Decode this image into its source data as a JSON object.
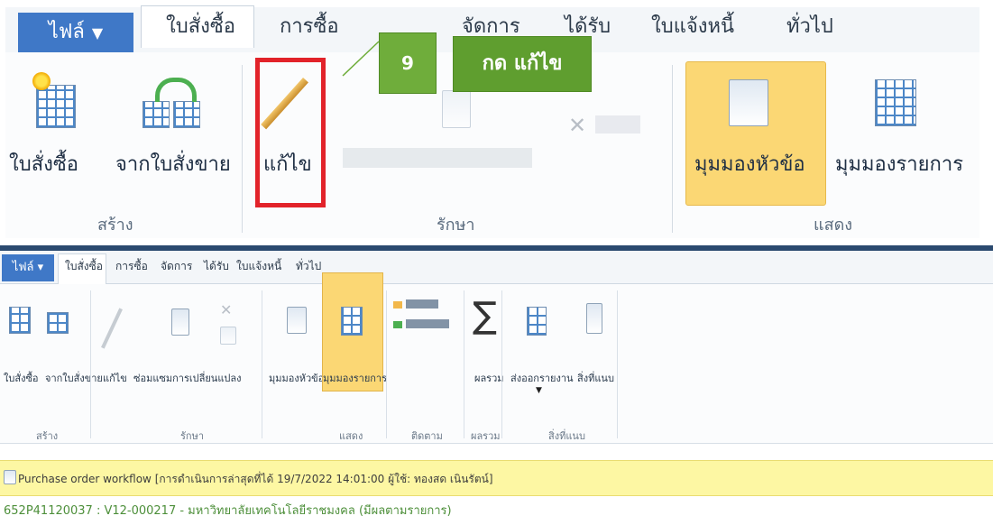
{
  "top": {
    "file_tab": "ไฟล์",
    "tabs": [
      "ใบสั่งซื้อ",
      "การซื้อ",
      "จัดการ",
      "ได้รับ",
      "ใบแจ้งหนี้",
      "ทั่วไป"
    ],
    "buttons": {
      "purchase_order": "ใบสั่งซื้อ",
      "from_sales_order": "จากใบสั่งขาย",
      "edit": "แก้ไข",
      "view_header": "มุมมองหัวข้อ",
      "view_lines": "มุมมองรายการ"
    },
    "groups": {
      "new": "สร้าง",
      "maintain": "รักษา",
      "show": "แสดง"
    },
    "callout": {
      "step": "9",
      "text": "กด แก้ไข"
    }
  },
  "bottom": {
    "file_tab": "ไฟล์",
    "tabs": [
      "ใบสั่งซื้อ",
      "การซื้อ",
      "จัดการ",
      "ได้รับ",
      "ใบแจ้งหนี้",
      "ทั่วไป"
    ],
    "groups": [
      "สร้าง",
      "รักษา",
      "แสดง",
      "ติดตาม",
      "ผลรวม",
      "สิ่งที่แนบ"
    ],
    "buttons": [
      "ใบสั่งซื้อ",
      "จากใบสั่งขาย",
      "แก้ไข",
      "ซ่อมแซมการเปลี่ยนแปลง",
      "มุมมองหัวข้อ",
      "มุมมองรายการ",
      "ผลรวม",
      "ส่งออกรายงาน",
      "สิ่งที่แนบ"
    ],
    "notice": "Purchase order workflow [การดำเนินการล่าสุดที่ได้ 19/7/2022 14:01:00 ผู้ใช้: ทองสด เนินรัตน์]",
    "record_title": "652P41120037 : V12-000217 - มหาวิทยาลัยเทคโนโลยีราชมงคล (มีผลตามรายการ)"
  }
}
